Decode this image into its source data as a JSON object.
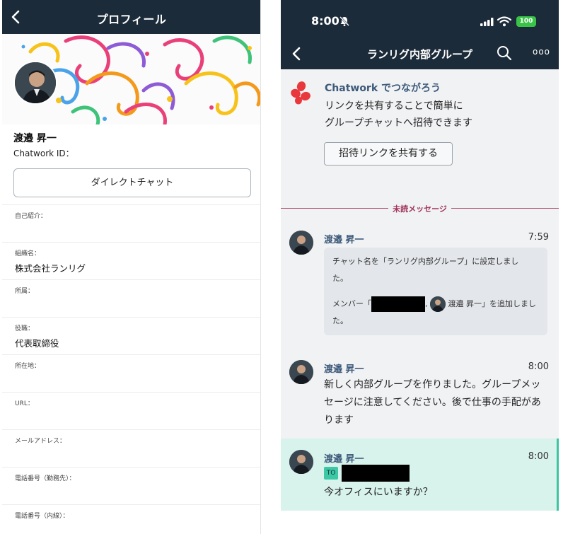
{
  "profile": {
    "header_title": "プロフィール",
    "name": "渡邉 昇一",
    "chatwork_id_label": "Chatwork ID：",
    "direct_chat_label": "ダイレクトチャット",
    "fields": [
      {
        "label": "自己紹介：",
        "value": ""
      },
      {
        "label": "組織名：",
        "value": "株式会社ランリグ"
      },
      {
        "label": "所属：",
        "value": ""
      },
      {
        "label": "役職：",
        "value": "代表取締役"
      },
      {
        "label": "所在地：",
        "value": ""
      },
      {
        "label": "URL：",
        "value": ""
      },
      {
        "label": "メールアドレス：",
        "value": ""
      },
      {
        "label": "電話番号（勤務先）：",
        "value": ""
      },
      {
        "label": "電話番号（内線）：",
        "value": ""
      }
    ]
  },
  "chat": {
    "status_bar": {
      "time": "8:00",
      "battery": "100"
    },
    "header_title": "ランリグ内部グループ",
    "more_label": "ooo",
    "invite": {
      "heading": "Chatwork でつながろう",
      "line1": "リンクを共有することで簡単に",
      "line2": "グループチャットへ招待できます",
      "button_label": "招待リンクを共有する"
    },
    "unread_label": "未読メッセージ",
    "messages": [
      {
        "sender": "渡邉 昇一",
        "time": "7:59",
        "system_line1": "チャット名を「ランリグ内部グループ」に設定しまし",
        "system_line2": "た。",
        "member_prefix": "メンバー「",
        "member_mid": ",",
        "member_name": "渡邉 昇一",
        "member_suffix": "」を追加しまし",
        "member_line2": "た。"
      },
      {
        "sender": "渡邉 昇一",
        "time": "8:00",
        "text": "新しく内部グループを作りました。グループメッセージに注意してください。後で仕事の手配があります"
      },
      {
        "sender": "渡邉 昇一",
        "time": "8:00",
        "to_label": "TO",
        "text": "今オフィスにいますか？"
      }
    ]
  },
  "colors": {
    "header_bg": "#1c2b3a",
    "sender_name": "#3d5a7a",
    "unread_accent": "#a0355c",
    "highlight_bg": "#d8f2ec",
    "highlight_bar": "#3cc4a3"
  }
}
